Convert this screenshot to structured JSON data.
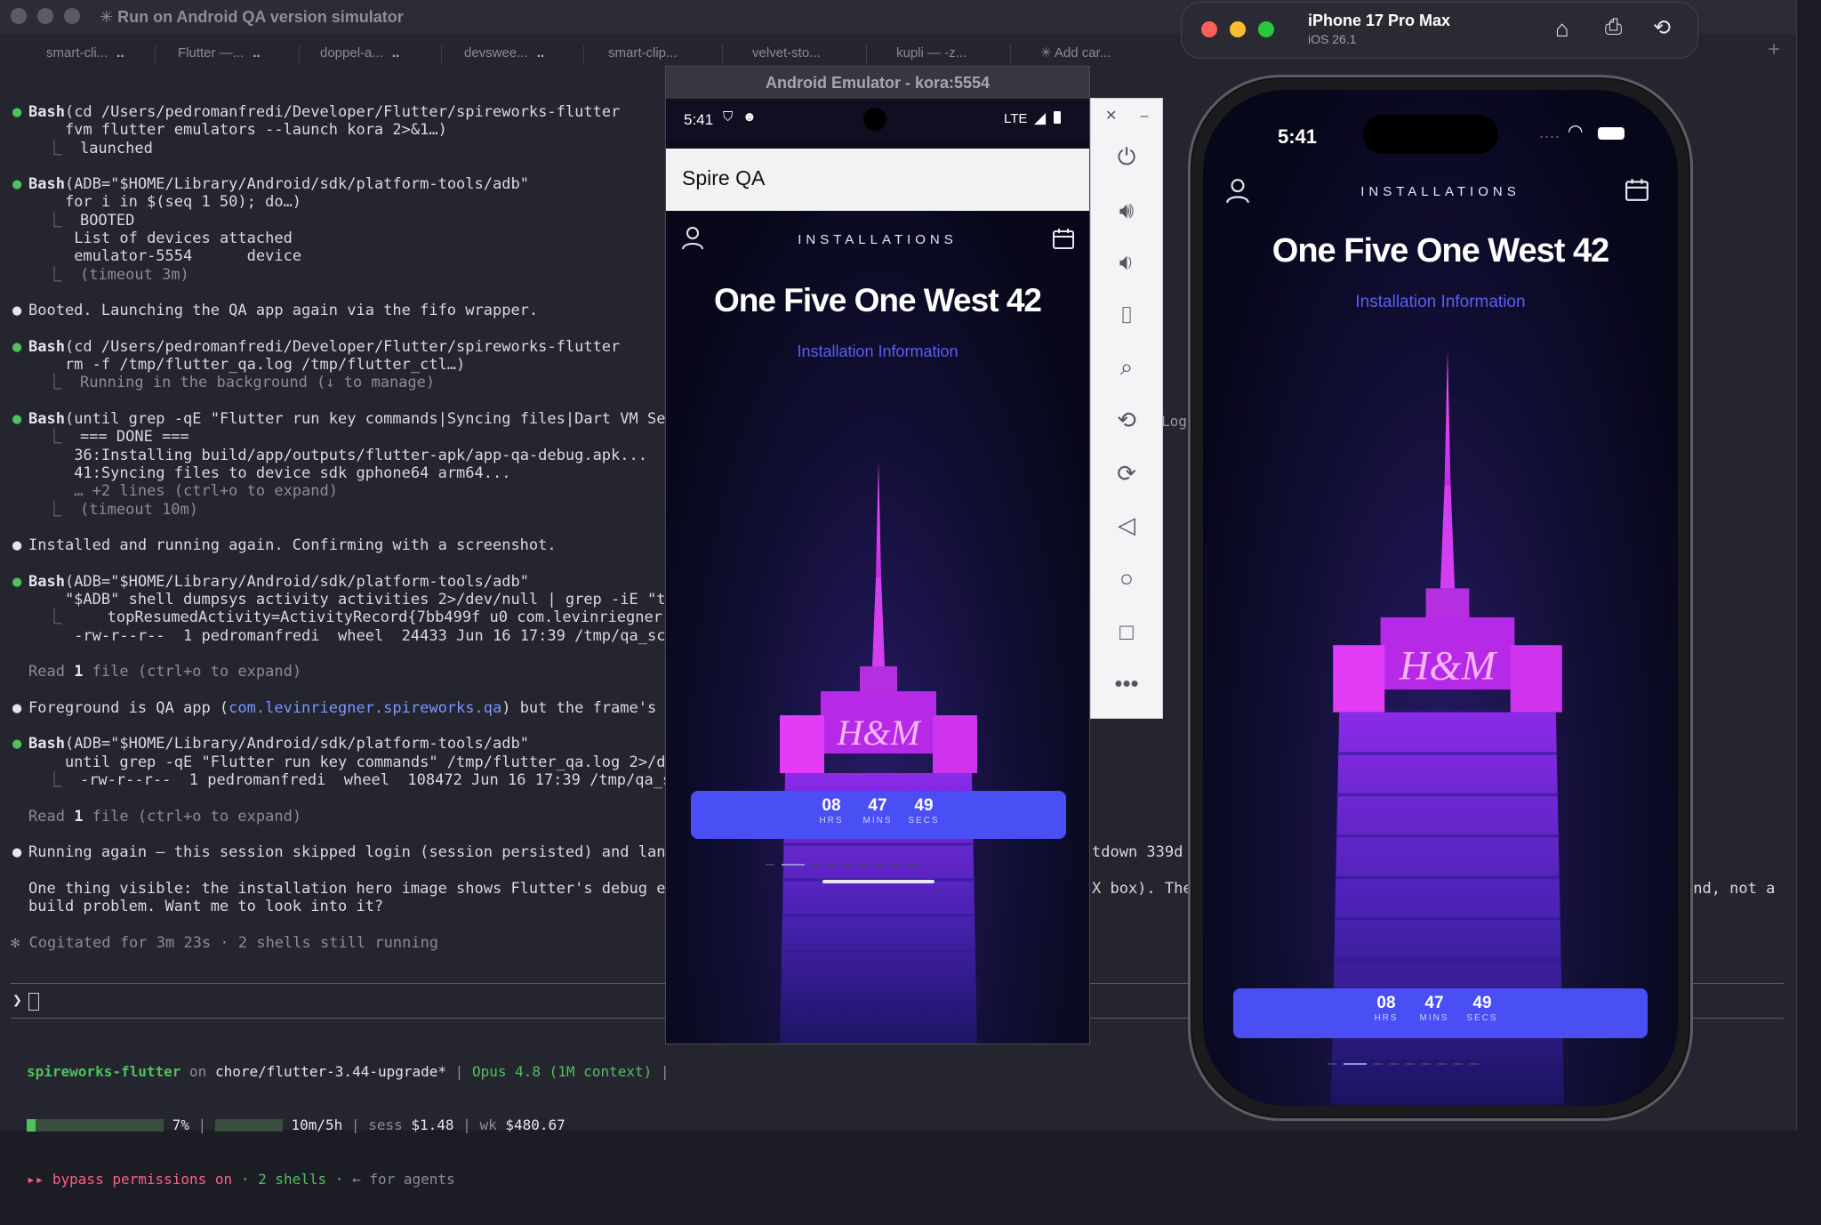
{
  "terminal": {
    "title": "✳ Run on Android QA version simulator",
    "tabs": [
      "smart-cli...",
      "Flutter —...",
      "doppel-a...",
      "devswee...",
      "smart-clip...",
      "velvet-sto...",
      "kupli — -z...",
      "✳ Add car..."
    ],
    "tab_more": "..",
    "tab_plus": "+",
    "lines": {
      "l1a": "Bash",
      "l1b": "(cd /Users/pedromanfredi/Developer/Flutter/spireworks-flutter",
      "l2": "    fvm flutter emulators --launch kora 2>&1…)",
      "l3": "launched",
      "l4a": "Bash",
      "l4b": "(ADB=\"$HOME/Library/Android/sdk/platform-tools/adb\"",
      "l5": "    for i in $(seq 1 50); do…)",
      "l6": "BOOTED",
      "l7": "List of devices attached",
      "l8": "emulator-5554      device",
      "l9": "(timeout 3m)",
      "l10": "Booted. Launching the QA app again via the fifo wrapper.",
      "l11a": "Bash",
      "l11b": "(cd /Users/pedromanfredi/Developer/Flutter/spireworks-flutter",
      "l12": "    rm -f /tmp/flutter_qa.log /tmp/flutter_ctl…)",
      "l13": "Running in the background (↓ to manage)",
      "l14a": "Bash",
      "l14b": "(until grep -qE \"Flutter run key commands|Syncing files|Dart VM Service",
      "l15": "=== DONE ===",
      "l16": "36:Installing build/app/outputs/flutter-apk/app-qa-debug.apk...        15",
      "l17": "41:Syncing files to device sdk gphone64 arm64...",
      "l18": "… +2 lines (ctrl+o to expand)",
      "l19": "(timeout 10m)",
      "l20": "Installed and running again. Confirming with a screenshot.",
      "l21a": "Bash",
      "l21b": "(ADB=\"$HOME/Library/Android/sdk/platform-tools/adb\"",
      "l22": "    \"$ADB\" shell dumpsys activity activities 2>/dev/null | grep -iE \"topResu",
      "l23": "topResumedActivity=ActivityRecord{7bb499f u0 com.levinriegner.spirewo",
      "l24": "-rw-r--r--  1 pedromanfredi  wheel  24433 Jun 16 17:39 /tmp/qa_screen2.pn",
      "l25a": "Read ",
      "l25b": "1",
      "l25c": " file (ctrl+o to expand)",
      "l26a": "Foreground is QA app (",
      "l26b": "com.levinriegner.spireworks.qa",
      "l26c": ") but the frame's still",
      "l27a": "Bash",
      "l27b": "(ADB=\"$HOME/Library/Android/sdk/platform-tools/adb\"",
      "l28": "    until grep -qE \"Flutter run key commands\" /tmp/flutter_qa.log 2>/dev/nul",
      "l29": "-rw-r--r--  1 pedromanfredi  wheel  108472 Jun 16 17:39 /tmp/qa_screen3.p",
      "l30a": "Read ",
      "l30b": "1",
      "l30c": " file (ctrl+o to expand)",
      "l31": "Running again — this session skipped login (session persisted) and landed on",
      "l31r": "tdown 339d (",
      "l32": "One thing visible: the installation hero image shows Flutter's debug error p",
      "l32r1": "X box). The",
      "l32r2": "end, not a",
      "l33": "build problem. Want me to look into it?",
      "l34": "✻ Cogitated for 3m 23s · 2 shells still running"
    },
    "prompt": "❯",
    "status": {
      "project": "spireworks-flutter",
      "on": "on",
      "branch": "chore/flutter-3.44-upgrade*",
      "model": "Opus 4.8 (1M context)",
      "ctx_pct": "7%",
      "ctx_value": 0.07,
      "time": "10m/5h",
      "sess_label": "sess",
      "sess": "$1.48",
      "wk_label": "wk",
      "wk": "$480.67",
      "bypass": "▸▸ bypass permissions on",
      "shells": "· 2 shells ·",
      "agents": "← for agents"
    }
  },
  "android": {
    "window_title": "Android Emulator - kora:5554",
    "status_time": "5:41",
    "status_net": "LTE",
    "appbar_title": "Spire QA",
    "log_fragment": "Log"
  },
  "ios": {
    "device": "iPhone 17 Pro Max",
    "os": "iOS 26.1",
    "status_time": "5:41"
  },
  "app": {
    "header": "INSTALLATIONS",
    "title": "One Five One West 42",
    "link": "Installation Information",
    "timer": {
      "hrs": "08",
      "hrs_label": "HRS",
      "mins": "47",
      "mins_label": "MINS",
      "secs": "49",
      "secs_label": "SECS"
    },
    "page_count": 9,
    "page_index": 1,
    "colors": {
      "accent": "#4a4ff5",
      "link": "#5b5df5",
      "tower_glow": "#e22cf5"
    }
  }
}
